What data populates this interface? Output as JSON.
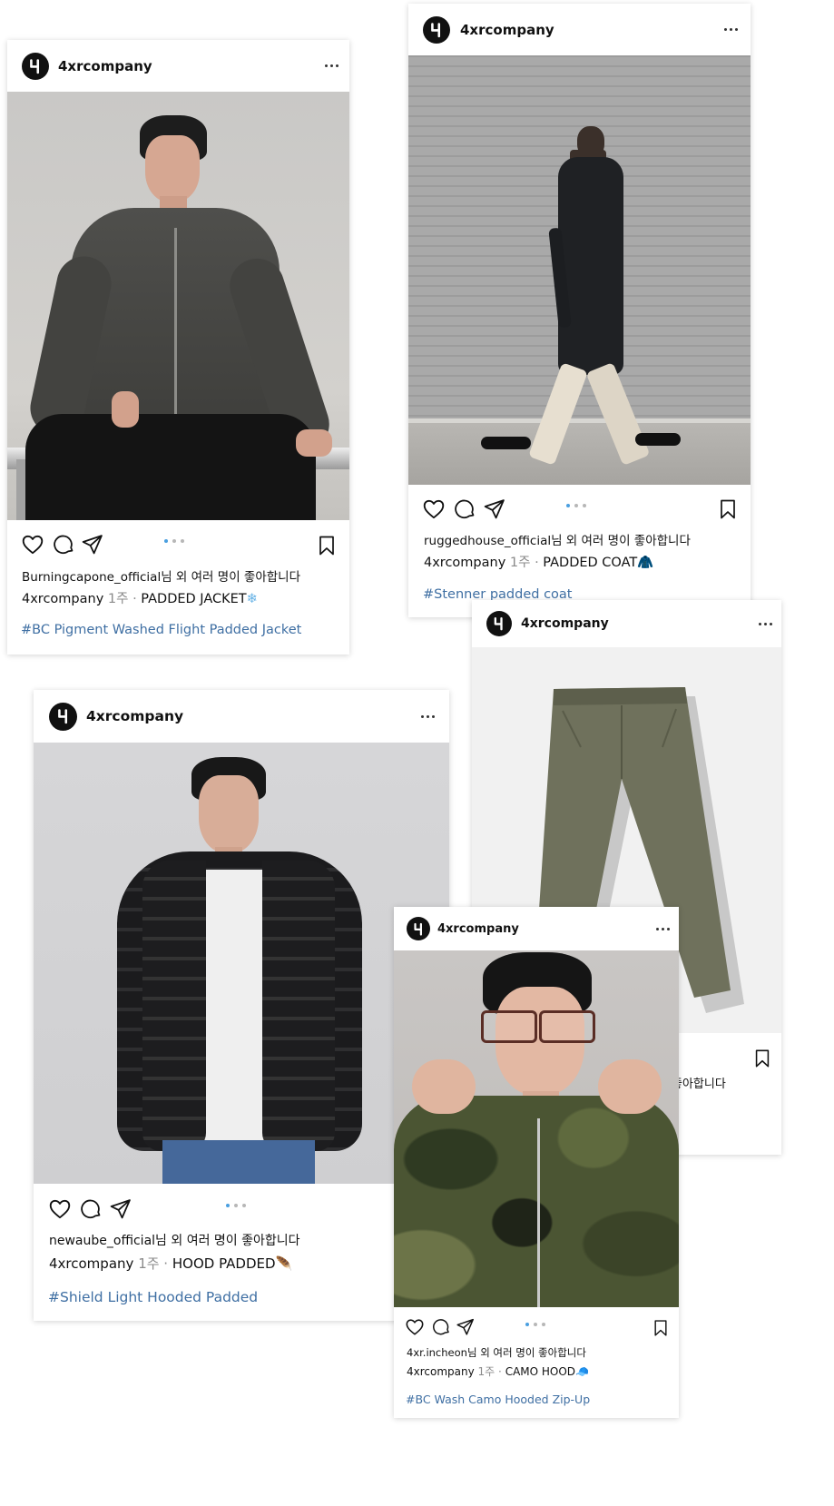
{
  "brand": {
    "accent_blue": "#4a9fe0",
    "hashtag_color": "#3f6fa3"
  },
  "posts": [
    {
      "username": "4xrcompany",
      "liked_by": "Burningcapone_official",
      "liked_suffix": "님 외 여러 명이 좋아합니다",
      "caption_user": "4xrcompany",
      "caption_time": "1주 ·",
      "caption_text": "PADDED JACKET",
      "caption_emoji": "❄",
      "hashtag": "#BC Pigment Washed Flight Padded Jacket",
      "icons": [
        "heart-icon",
        "comment-icon",
        "share-icon",
        "bookmark-icon",
        "more-icon"
      ]
    },
    {
      "username": "4xrcompany",
      "liked_by": "ruggedhouse_official",
      "liked_suffix": "님 외 여러 명이 좋아합니다",
      "caption_user": "4xrcompany",
      "caption_time": "1주 ·",
      "caption_text": "PADDED COAT",
      "caption_emoji": "🧥",
      "hashtag": "#Stenner padded coat",
      "icons": [
        "heart-icon",
        "comment-icon",
        "share-icon",
        "bookmark-icon",
        "more-icon"
      ]
    },
    {
      "username": "4xrcompany",
      "liked_suffix": "좋아합니다",
      "icons": [
        "bookmark-icon",
        "more-icon"
      ]
    },
    {
      "username": "4xrcompany",
      "liked_by": "newaube_official",
      "liked_suffix": "님 외 여러 명이 좋아합니다",
      "caption_user": "4xrcompany",
      "caption_time": "1주 ·",
      "caption_text": "HOOD PADDED",
      "caption_emoji": "🪶",
      "hashtag": "#Shield Light Hooded Padded",
      "icons": [
        "heart-icon",
        "comment-icon",
        "share-icon",
        "more-icon"
      ]
    },
    {
      "username": "4xrcompany",
      "liked_by": "4xr.incheon",
      "liked_suffix": "님 외 여러 명이 좋아합니다",
      "caption_user": "4xrcompany",
      "caption_time": "1주 ·",
      "caption_text": "CAMO HOOD",
      "caption_emoji": "🧢",
      "hashtag": "#BC Wash Camo Hooded Zip-Up",
      "icons": [
        "heart-icon",
        "comment-icon",
        "share-icon",
        "bookmark-icon",
        "more-icon"
      ]
    }
  ]
}
